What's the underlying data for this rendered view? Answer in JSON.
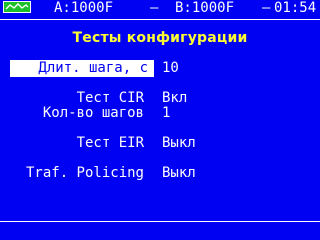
{
  "status_bar": {
    "channel_a": "A:1000F",
    "separator_1": "—",
    "channel_b": "B:1000F",
    "separator_2": "—",
    "clock": "01:54",
    "signal_icon_color": "#1dbf2a"
  },
  "title": "Тесты конфигурации",
  "settings": [
    {
      "label": "Длит. шага, с",
      "value": "10"
    },
    {
      "label": "Тест CIR",
      "value": "Вкл"
    },
    {
      "label": "Кол-во шагов",
      "value": "1"
    },
    {
      "label": "Тест EIR",
      "value": "Выкл"
    },
    {
      "label": "Traf. Policing",
      "value": "Выкл"
    }
  ],
  "colors": {
    "background": "#0000f2",
    "text": "#ffffff",
    "title": "#ffff33",
    "selection_bg": "#ffffff"
  }
}
